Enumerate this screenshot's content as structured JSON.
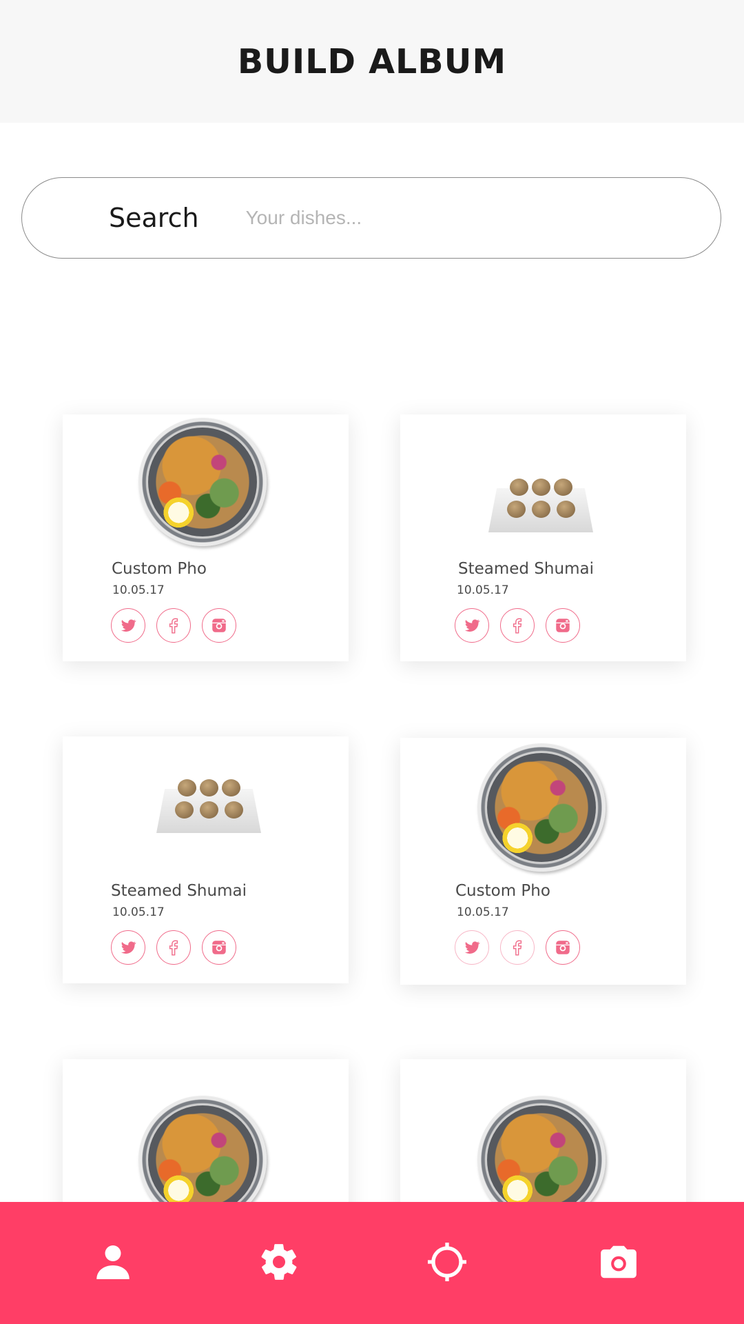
{
  "header": {
    "title": "BUILD ALBUM"
  },
  "search": {
    "label": "Search",
    "placeholder": "Your dishes..."
  },
  "cards": [
    {
      "name": "Custom Pho",
      "date": "10.05.17",
      "image": "pho-bowl"
    },
    {
      "name": "Steamed Shumai",
      "date": "10.05.17",
      "image": "shumai-tray"
    },
    {
      "name": "Steamed Shumai",
      "date": "10.05.17",
      "image": "shumai-tray"
    },
    {
      "name": "Custom Pho",
      "date": "10.05.17",
      "image": "pho-bowl"
    },
    {
      "image": "pho-bowl"
    },
    {
      "image": "pho-bowl"
    }
  ],
  "socials": [
    "twitter-icon",
    "facebook-icon",
    "instagram-icon"
  ],
  "bottom_nav": [
    "profile-icon",
    "gear-icon",
    "crosshair-icon",
    "camera-icon"
  ],
  "colors": {
    "accent": "#ff3e66",
    "icon_outline": "#f06b8a",
    "header_bg": "#f7f7f7"
  }
}
